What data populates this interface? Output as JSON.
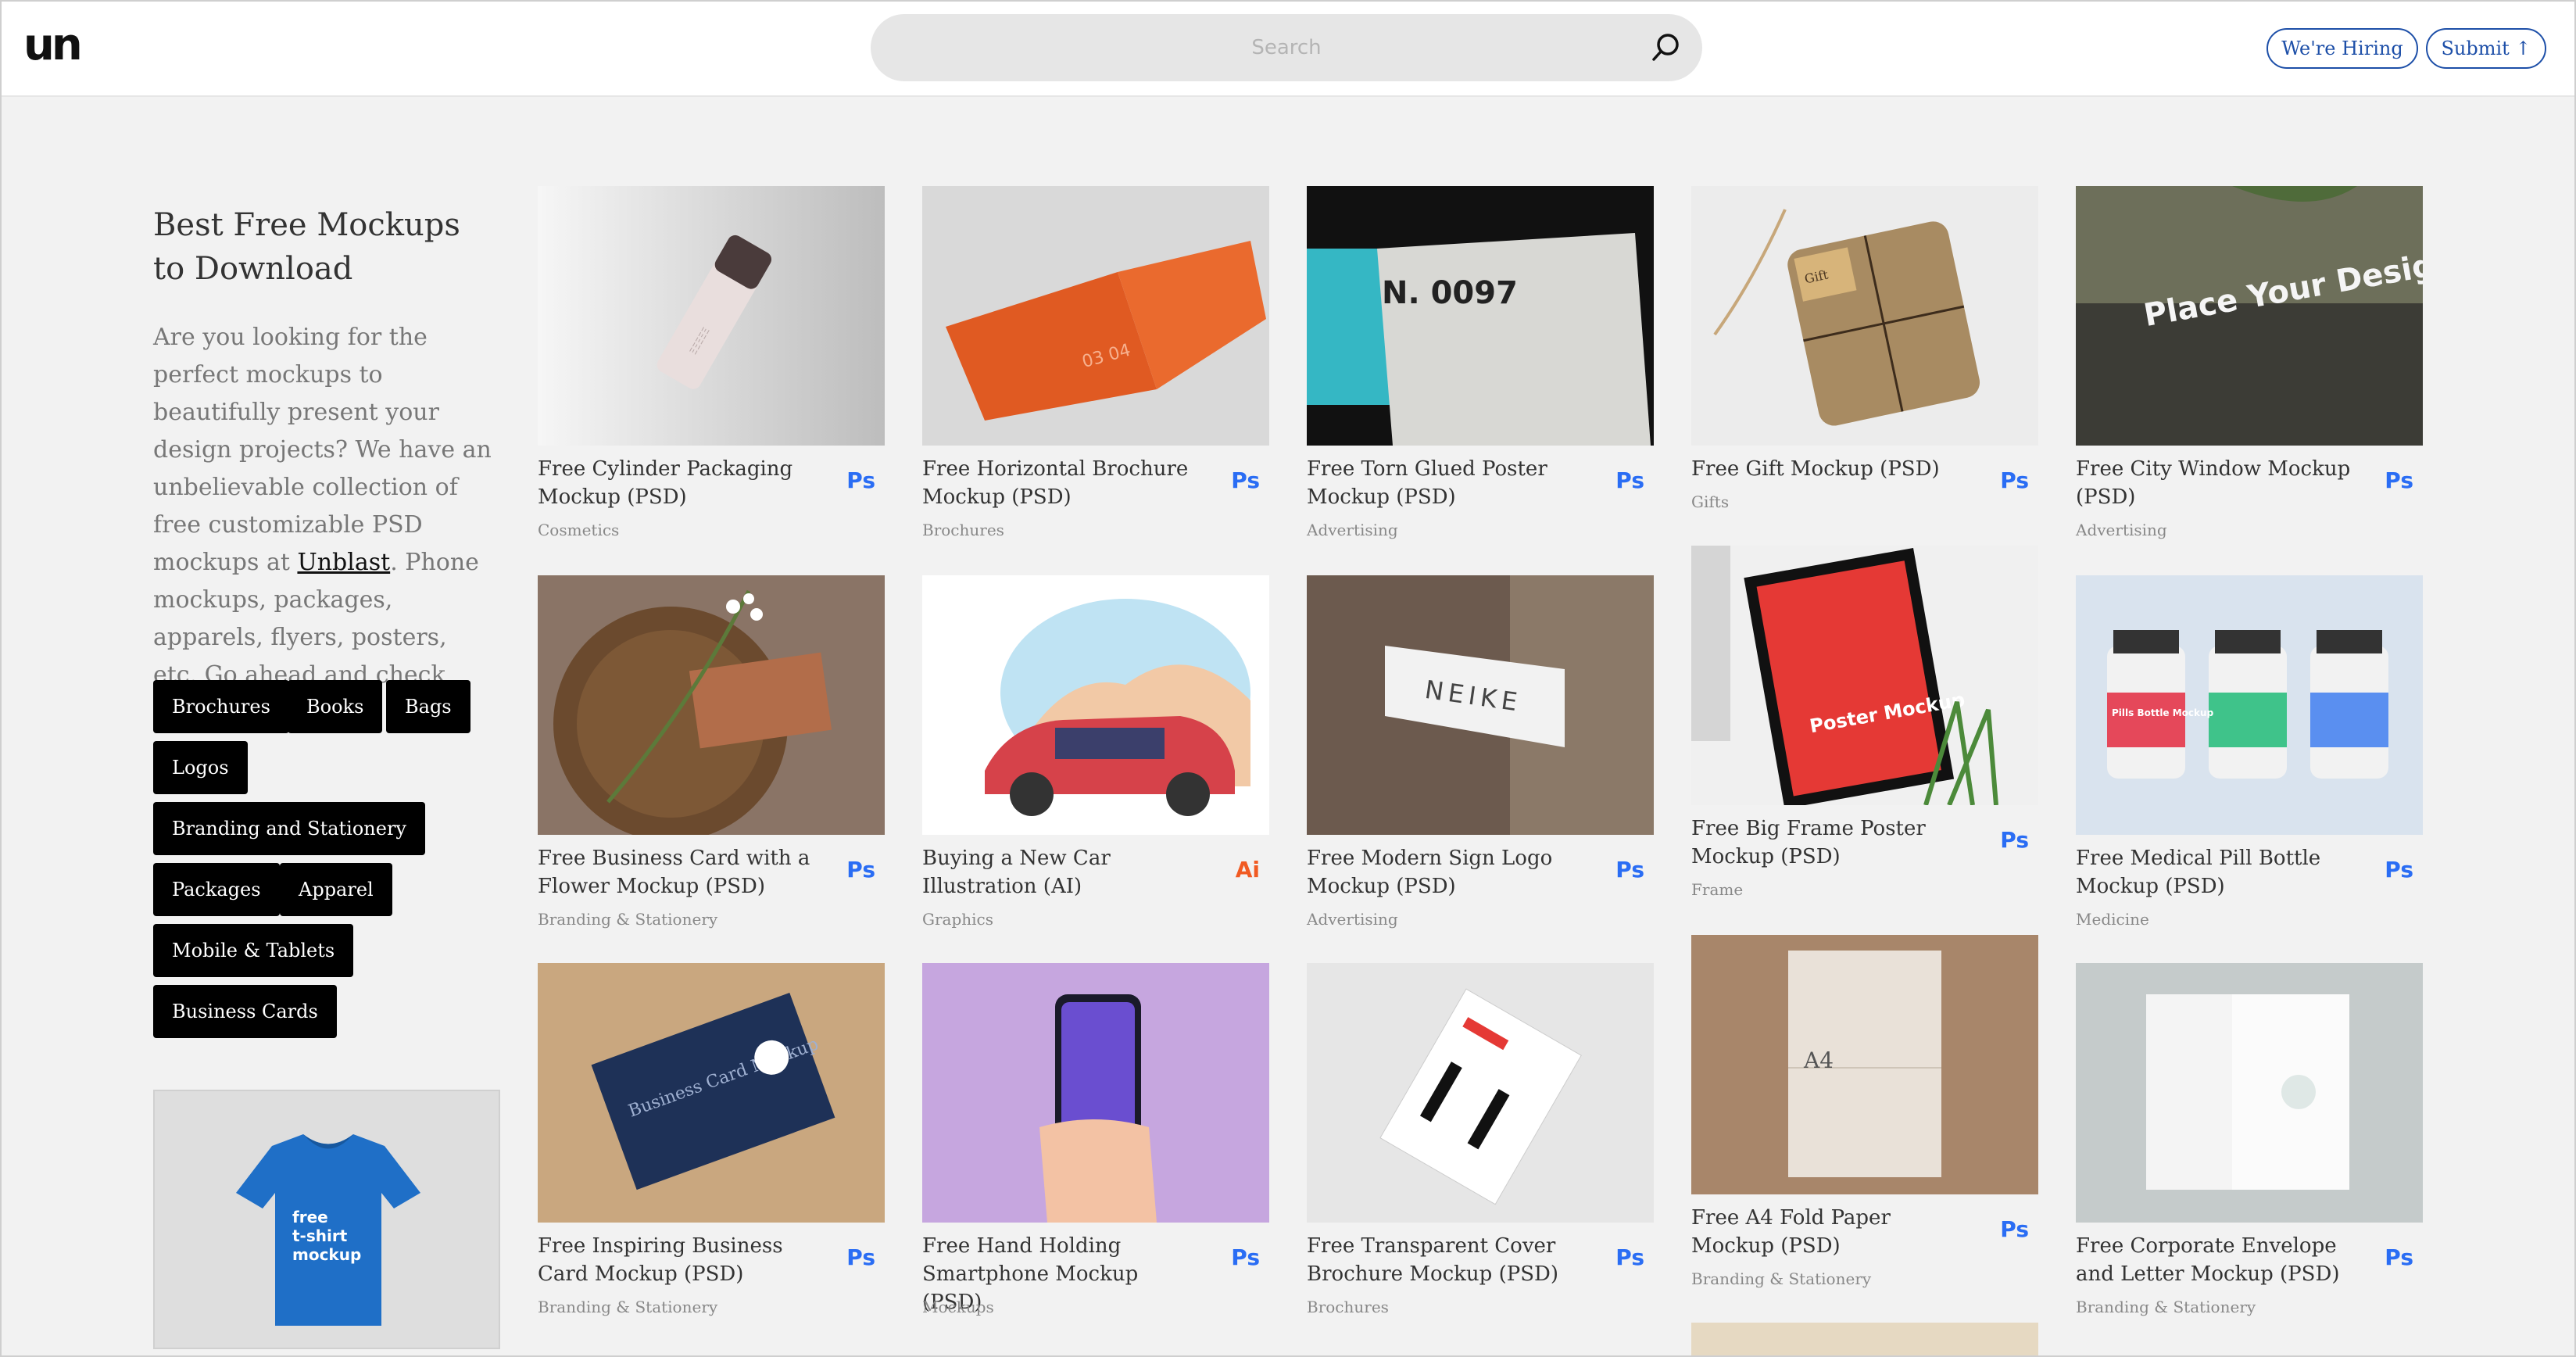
{
  "header": {
    "logo": "un",
    "search_placeholder": "Search",
    "hiring_label": "We're Hiring",
    "submit_label": "Submit ↑"
  },
  "intro": {
    "title": "Best Free Mockups to Download",
    "text_before": "Are you looking for the perfect mockups to beautifully present your design projects? We have an unbelievable collection of free customizable PSD mockups at ",
    "link": "Unblast",
    "text_after": ". Phone mockups, packages, apparels, flyers, posters, etc. Go ahead and check them out."
  },
  "tags": [
    "Brochures",
    "Books",
    "Bags",
    "Logos",
    "Branding and Stationery",
    "Packages",
    "Apparel",
    "Mobile & Tablets",
    "Business Cards"
  ],
  "promo": {
    "line1": "free",
    "line2": "t-shirt",
    "line3": "mockup"
  },
  "cards": [
    {
      "title": "Free Cylinder Packaging Mockup (PSD)",
      "badge": "Ps",
      "category": "Cosmetics",
      "thumb_text": "ΞΞΞΞΞ"
    },
    {
      "title": "Free Horizontal Brochure Mockup (PSD)",
      "badge": "Ps",
      "category": "Brochures",
      "thumb_text": "03   04"
    },
    {
      "title": "Free Torn Glued Poster Mockup (PSD)",
      "badge": "Ps",
      "category": "Advertising",
      "thumb_text": "N. 0097"
    },
    {
      "title": "Free Gift Mockup (PSD)",
      "badge": "Ps",
      "category": "Gifts",
      "thumb_text": "Gift"
    },
    {
      "title": "Free City Window Mockup (PSD)",
      "badge": "Ps",
      "category": "Advertising",
      "thumb_text": "Place Your Design Here"
    },
    {
      "title": "Free Business Card with a Flower Mockup (PSD)",
      "badge": "Ps",
      "category": "Branding & Stationery",
      "thumb_text": ""
    },
    {
      "title": "Buying a New Car Illustration (AI)",
      "badge": "Ai",
      "category": "Graphics",
      "thumb_text": ""
    },
    {
      "title": "Free Modern Sign Logo Mockup (PSD)",
      "badge": "Ps",
      "category": "Advertising",
      "thumb_text": "NEIKE"
    },
    {
      "title": "Free Big Frame Poster Mockup (PSD)",
      "badge": "Ps",
      "category": "Frame",
      "thumb_text": "Poster Mockup"
    },
    {
      "title": "Free Medical Pill Bottle Mockup (PSD)",
      "badge": "Ps",
      "category": "Medicine",
      "thumb_text": "Pills Bottle Mockup"
    },
    {
      "title": "Free Inspiring Business Card Mockup (PSD)",
      "badge": "Ps",
      "category": "Branding & Stationery",
      "thumb_text": "Business Card Mockup"
    },
    {
      "title": "Free Hand Holding Smartphone Mockup (PSD)",
      "badge": "Ps",
      "category": "Mockups",
      "thumb_text": ""
    },
    {
      "title": "Free Transparent Cover Brochure Mockup (PSD)",
      "badge": "Ps",
      "category": "Brochures",
      "thumb_text": ""
    },
    {
      "title": "Free A4 Fold Paper Mockup (PSD)",
      "badge": "Ps",
      "category": "Branding & Stationery",
      "thumb_text": "A4"
    },
    {
      "title": "Free Corporate Envelope and Letter Mockup (PSD)",
      "badge": "Ps",
      "category": "Branding & Stationery",
      "thumb_text": ""
    }
  ],
  "colors": {
    "accent": "#1d4fa8",
    "ps_badge": "#2a6df4",
    "ai_badge": "#f15a22",
    "tag_bg": "#000000"
  }
}
